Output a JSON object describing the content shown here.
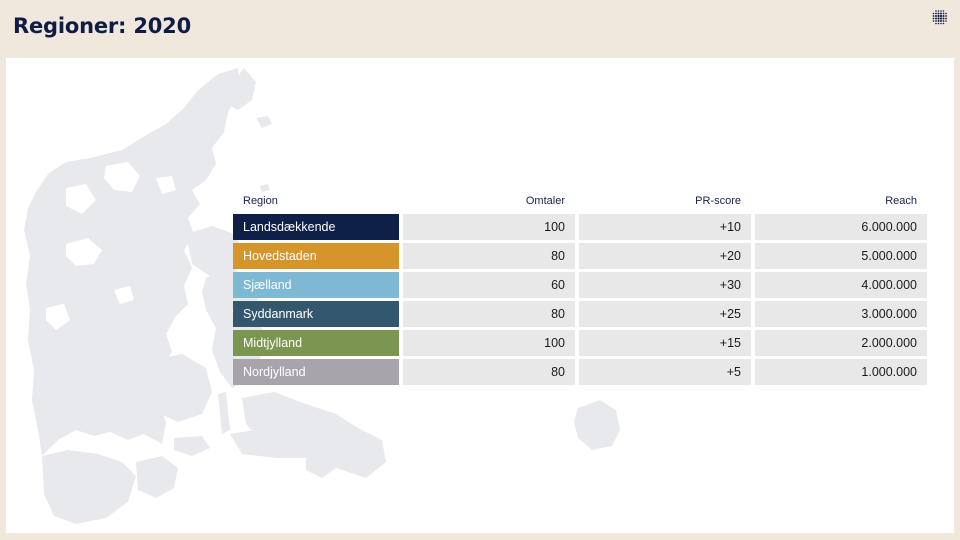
{
  "header": {
    "title": "Regioner: 2020"
  },
  "logo": {
    "icon": "dotted-sphere-icon"
  },
  "table": {
    "headers": {
      "region": "Region",
      "omtaler": "Omtaler",
      "pr_score": "PR-score",
      "reach": "Reach"
    },
    "rows": [
      {
        "region": "Landsdækkende",
        "color": "#0f2048",
        "omtaler": "100",
        "pr_score": "+10",
        "reach": "6.000.000"
      },
      {
        "region": "Hovedstaden",
        "color": "#d6952a",
        "omtaler": "80",
        "pr_score": "+20",
        "reach": "5.000.000"
      },
      {
        "region": "Sjælland",
        "color": "#7db9d5",
        "omtaler": "60",
        "pr_score": "+30",
        "reach": "4.000.000"
      },
      {
        "region": "Syddanmark",
        "color": "#33586e",
        "omtaler": "80",
        "pr_score": "+25",
        "reach": "3.000.000"
      },
      {
        "region": "Midtjylland",
        "color": "#7a9651",
        "omtaler": "100",
        "pr_score": "+15",
        "reach": "2.000.000"
      },
      {
        "region": "Nordjylland",
        "color": "#a7a5ab",
        "omtaler": "80",
        "pr_score": "+5",
        "reach": "1.000.000"
      }
    ]
  },
  "colors": {
    "background": "#f0e7dd",
    "title": "#0f1d45",
    "panel": "#ffffff",
    "map_fill": "#e8e9ec",
    "cell_fill": "#e8e8e9"
  }
}
